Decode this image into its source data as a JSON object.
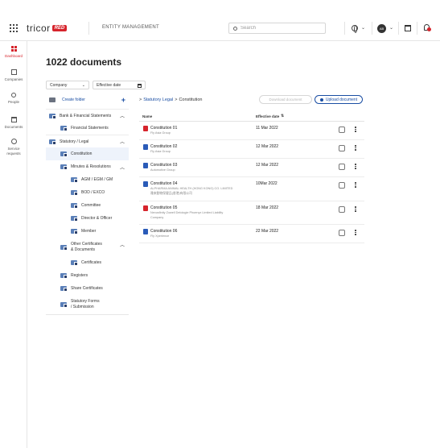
{
  "header": {
    "logo_text": "tricor",
    "logo_badge": "RED",
    "app_title": "ENTITY MANAGEMENT",
    "search_placeholder": "Search",
    "avatar_initials": "AB"
  },
  "sidenav": {
    "items": [
      {
        "label": "Dashboard",
        "icon": "dashboard-icon",
        "active": true
      },
      {
        "label": "Companies",
        "icon": "building-icon",
        "active": false
      },
      {
        "label": "People",
        "icon": "people-icon",
        "active": false
      },
      {
        "label": "Documents",
        "icon": "folder-icon",
        "active": false
      },
      {
        "label": "Service requests",
        "icon": "check-circle-icon",
        "active": false
      }
    ]
  },
  "page": {
    "title": "1022 documents"
  },
  "filters": {
    "company": "Company",
    "effective_date": "Effective date"
  },
  "tree": {
    "create_folder": "Create folder",
    "items": [
      {
        "label": "Bank & Financial Statements",
        "level": 0,
        "expanded": true
      },
      {
        "label": "Financial Statements",
        "level": 1
      },
      {
        "label": "Statutory / Legal",
        "level": 0,
        "expanded": true
      },
      {
        "label": "Constitution",
        "level": 1,
        "selected": true
      },
      {
        "label": "Minutes & Resolutions",
        "level": 1,
        "expanded": true
      },
      {
        "label": "AGM / EGM / GM",
        "level": 2
      },
      {
        "label": "BOD / EXCO",
        "level": 2
      },
      {
        "label": "Committee",
        "level": 2
      },
      {
        "label": "Director & Officer",
        "level": 2
      },
      {
        "label": "Member",
        "level": 2
      },
      {
        "label": "Other Certificates",
        "label2": "& Documents",
        "level": 1,
        "expanded": true
      },
      {
        "label": "Certificates",
        "level": 2
      },
      {
        "label": "Registers",
        "level": 1
      },
      {
        "label": "Share Certificates",
        "level": 1
      },
      {
        "label": "Statutory Forms",
        "label2": "/ Submission",
        "level": 1
      }
    ]
  },
  "breadcrumb": {
    "prefix": ">",
    "parent": "Statutory Legal",
    "separator": ">",
    "current": "Constitution"
  },
  "actions": {
    "download": "Download document",
    "upload": "Upload document"
  },
  "table": {
    "col_name": "Name",
    "col_date": "Effective date",
    "rows": [
      {
        "title": "Constitution 01",
        "sub": "Fly Asia Group",
        "date": "11 Mar 2022",
        "type": "pdf"
      },
      {
        "title": "Constitution 02",
        "sub": "Fly Asia Group",
        "date": "12 Mar 2022",
        "type": "word"
      },
      {
        "title": "Constitution 03",
        "sub": "Automotive Group",
        "date": "12 Mar 2022",
        "type": "word"
      },
      {
        "title": "Constitution 04",
        "sub": "ALPHARMA ANIMAL HEALTH (HONG KONG) CO. LIMITED",
        "sub2": "雅来動物保健品(香港)有限公司",
        "date": "10Mar 2022",
        "type": "word"
      },
      {
        "title": "Constitution 05",
        "sub": "Nexusfinity Zowell Delologie Phoenyx Limited Liability",
        "sub2": "Company",
        "date": "18 Mar 2022",
        "type": "pdf"
      },
      {
        "title": "Constitution 06",
        "sub": "Fly Xperience",
        "date": "22 Mar 2022",
        "type": "word"
      }
    ]
  },
  "colors": {
    "brand_red": "#d6242c",
    "link_blue": "#1a4ea3"
  }
}
